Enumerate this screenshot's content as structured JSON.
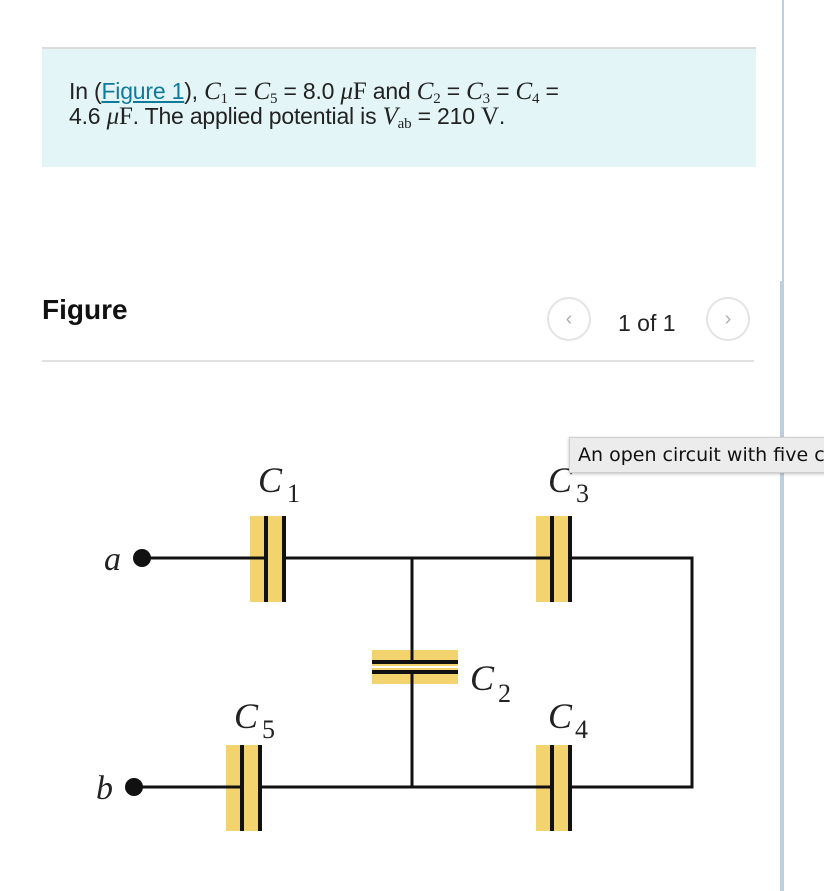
{
  "problem": {
    "intro": "In (",
    "figure_link": "Figure 1",
    "after_link": "), ",
    "c1": "C",
    "c1_sub": "1",
    "eq1": " = ",
    "c5": "C",
    "c5_sub": "5",
    "eq2": " = 8.0 ",
    "mu1": "μ",
    "farad1": "F",
    "and": " and ",
    "c2": "C",
    "c2_sub": "2",
    "eq3": " = ",
    "c3": "C",
    "c3_sub": "3",
    "eq4": " = ",
    "c4": "C",
    "c4_sub": "4",
    "eq5": " =",
    "val2": "4.6 ",
    "mu2": "μ",
    "farad2": "F",
    "applied": ". The applied potential is ",
    "v": "V",
    "v_sub": "ab",
    "eq6": " = 210 ",
    "volt": "V",
    "period": "."
  },
  "figure": {
    "heading": "Figure",
    "pager": {
      "prev_icon": "‹",
      "count": "1 of 1",
      "next_icon": "›"
    },
    "tooltip": "An open circuit with five capacitors",
    "labels": {
      "a": "a",
      "b": "b",
      "c1": "C",
      "c1_sub": "1",
      "c2": "C",
      "c2_sub": "2",
      "c3": "C",
      "c3_sub": "3",
      "c4": "C",
      "c4_sub": "4",
      "c5": "C",
      "c5_sub": "5"
    },
    "colors": {
      "plate_fill": "#f2d36e",
      "wire": "#111111"
    }
  }
}
